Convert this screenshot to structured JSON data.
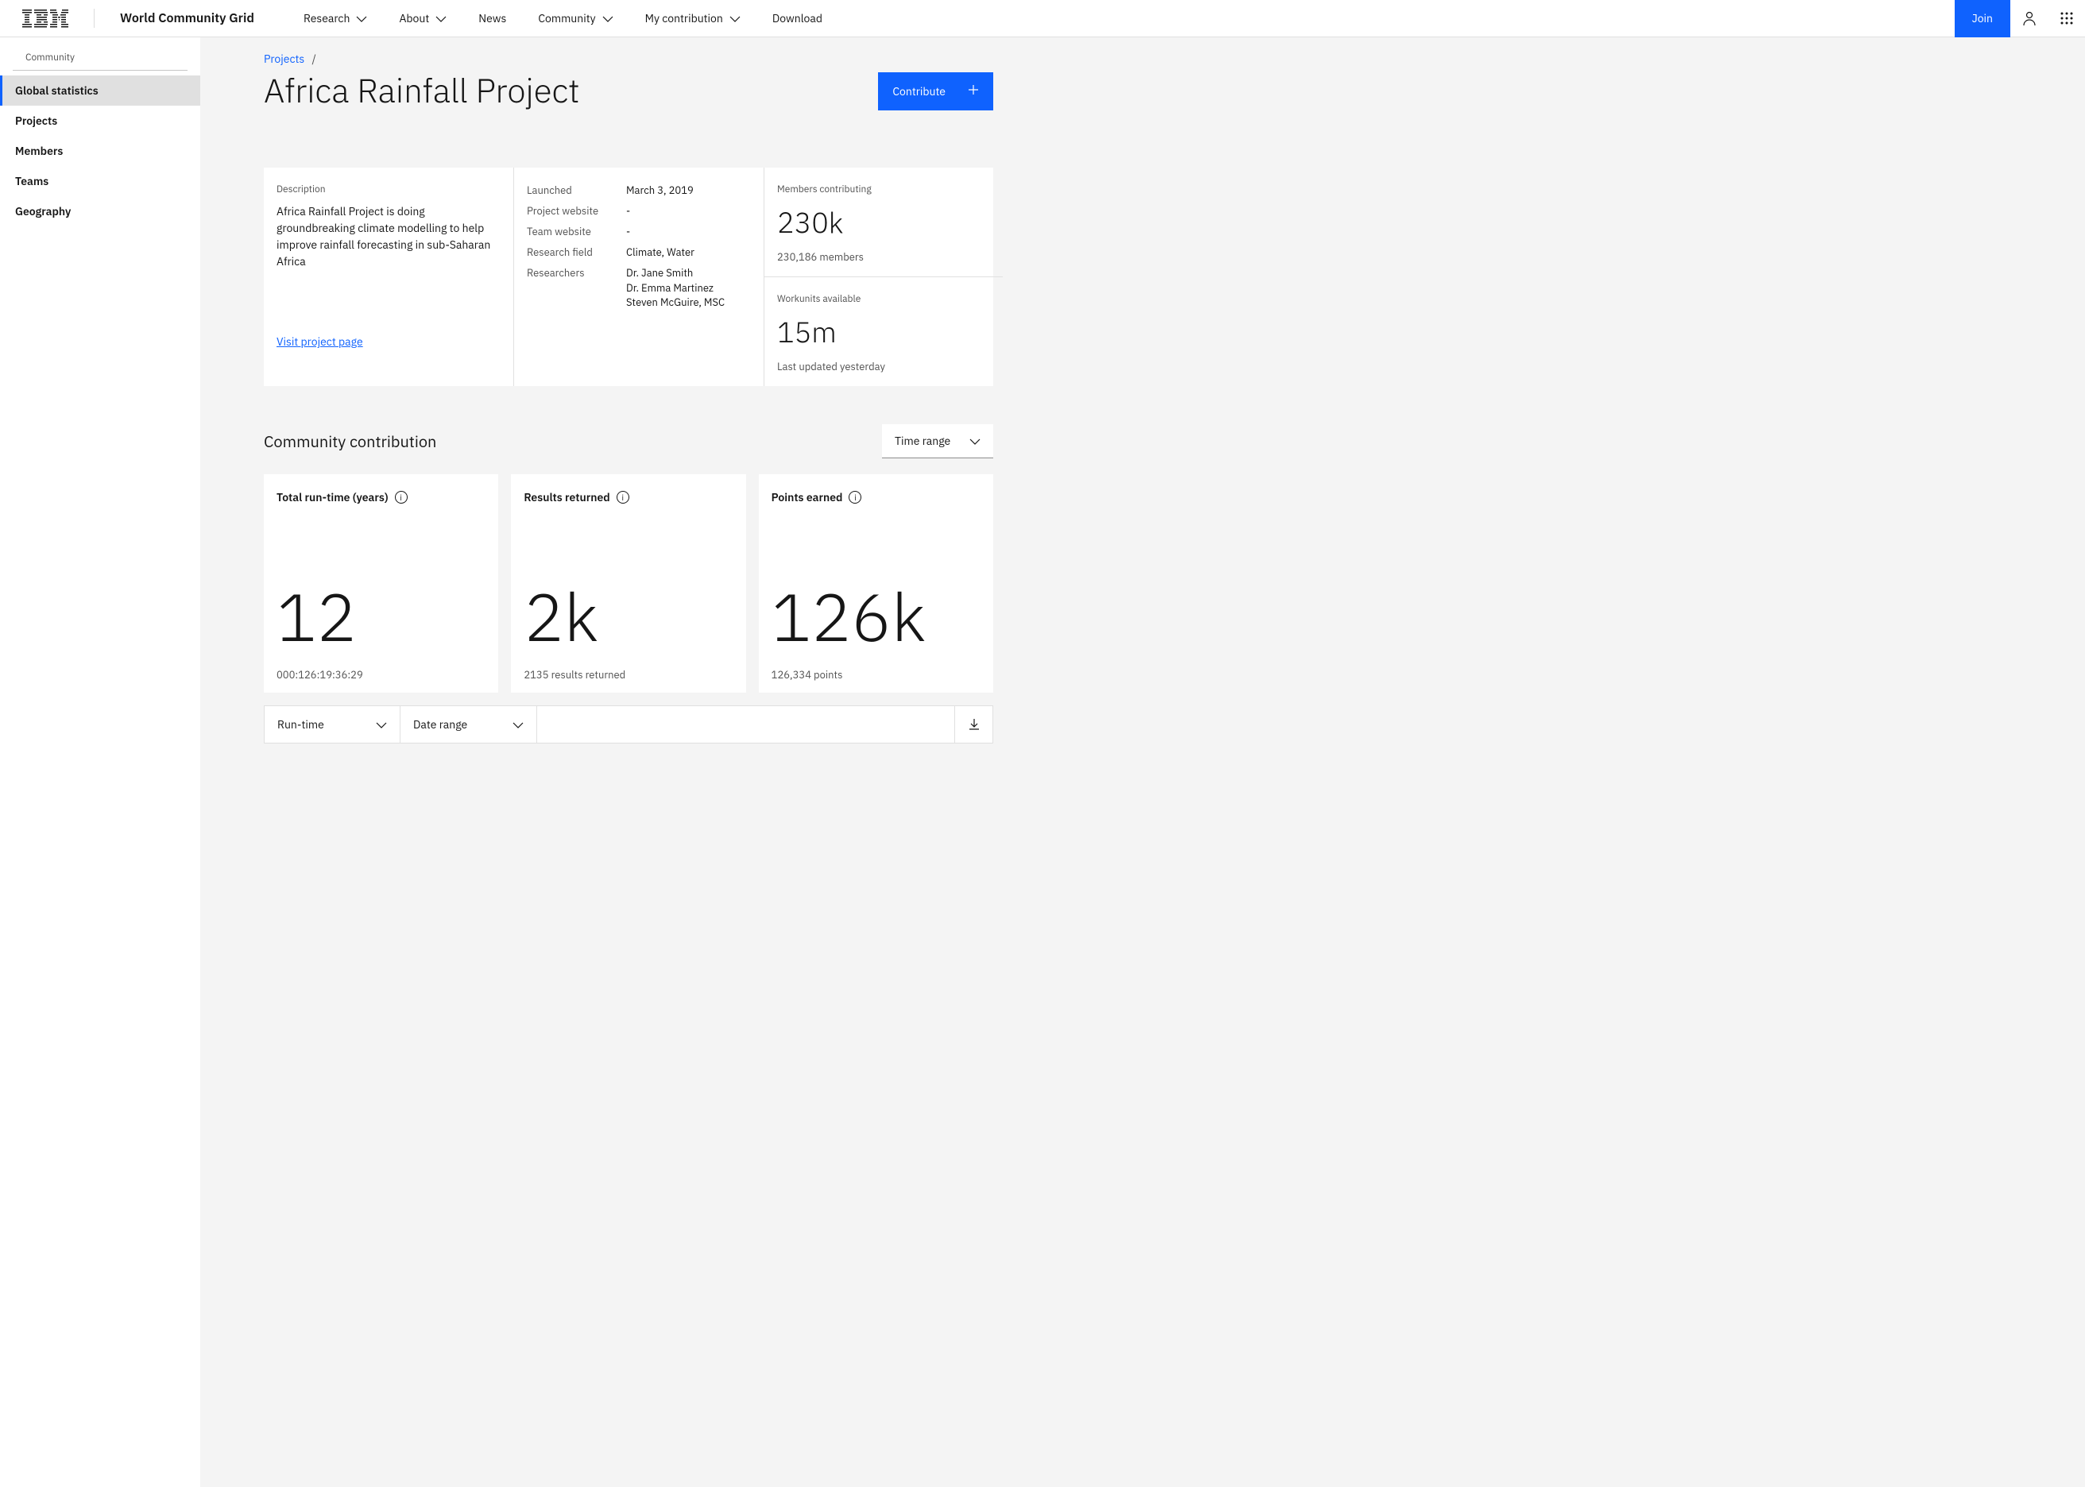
{
  "header": {
    "brand": "World Community Grid",
    "nav": [
      "Research",
      "About",
      "News",
      "Community",
      "My contribution",
      "Download"
    ],
    "nav_has_chev": [
      true,
      true,
      false,
      true,
      true,
      false
    ],
    "join": "Join"
  },
  "sidebar": {
    "label": "Community",
    "items": [
      "Global statistics",
      "Projects",
      "Members",
      "Teams",
      "Geography"
    ],
    "active_index": 0
  },
  "breadcrumb": {
    "root": "Projects",
    "sep": "/"
  },
  "title": "Africa Rainfall Project",
  "contribute": "Contribute",
  "info": {
    "desc_label": "Description",
    "desc": "Africa Rainfall Project is doing groundbreaking climate modelling to help improve rainfall forecasting in sub-Saharan Africa",
    "visit": "Visit project page",
    "meta": [
      {
        "k": "Launched",
        "v": "March 3, 2019"
      },
      {
        "k": "Project website",
        "v": "-"
      },
      {
        "k": "Team website",
        "v": "-"
      },
      {
        "k": "Research field",
        "v": "Climate, Water"
      }
    ],
    "researchers_label": "Researchers",
    "researchers": [
      "Dr. Jane Smith",
      "Dr. Emma Martinez",
      "Steven McGuire, MSC"
    ],
    "stat1": {
      "label": "Members contributing",
      "num": "230k",
      "sub": "230,186 members"
    },
    "stat2": {
      "label": "Workunits available",
      "num": "15m",
      "sub": "Last updated yesterday"
    }
  },
  "contrib": {
    "title": "Community contribution",
    "time_range": "Time range",
    "cards": [
      {
        "title": "Total run-time (years)",
        "num": "12",
        "foot": "000:126:19:36:29"
      },
      {
        "title": "Results returned",
        "num": "2k",
        "foot": "2135 results returned"
      },
      {
        "title": "Points earned",
        "num": "126k",
        "foot": "126,334 points"
      }
    ],
    "dd1": "Run-time",
    "dd2": "Date range"
  }
}
